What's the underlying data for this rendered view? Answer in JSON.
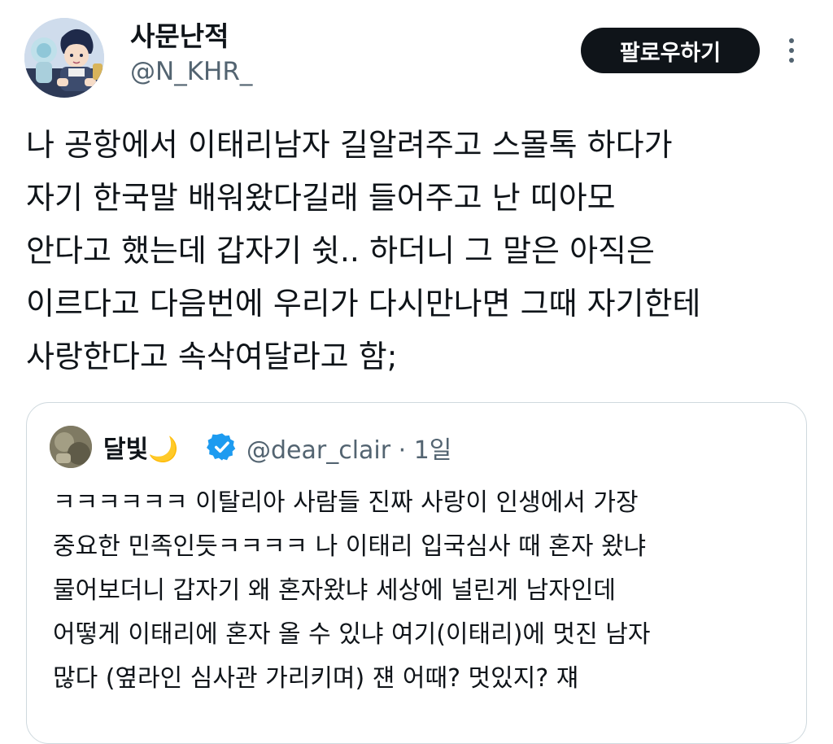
{
  "author": {
    "display_name": "사문난적",
    "handle": "@N_KHR_"
  },
  "header": {
    "follow_label": "팔로우하기",
    "more_icon": "more-vertical-icon"
  },
  "tweet": {
    "text": "나 공항에서 이태리남자 길알려주고 스몰톡 하다가\n자기 한국말 배워왔다길래 들어주고 난 띠아모\n안다고 했는데 갑자기 쉿.. 하더니 그 말은 아직은\n이르다고 다음번에 우리가 다시만나면 그때 자기한테\n사랑한다고 속삭여달라고 함;"
  },
  "quote": {
    "display_name": "달빛🌙",
    "verified_icon": "verified-badge-icon",
    "handle_time": "@dear_clair · 1일",
    "text": "ㅋㅋㅋㅋㅋㅋ 이탈리아 사람들 진짜 사랑이 인생에서 가장\n중요한 민족인듯ㅋㅋㅋㅋ 나 이태리 입국심사 때 혼자 왔냐\n물어보더니 갑자기 왜 혼자왔냐 세상에 널린게 남자인데\n어떻게 이태리에 혼자 올 수 있냐 여기(이태리)에 멋진 남자\n많다 (옆라인 심사관 가리키며) 쟨 어때? 멋있지? 쟤"
  },
  "colors": {
    "text": "#0f1419",
    "muted": "#536471",
    "border": "#cfd9de",
    "verified": "#1d9bf0",
    "button_bg": "#0f1419",
    "button_text": "#ffffff"
  }
}
